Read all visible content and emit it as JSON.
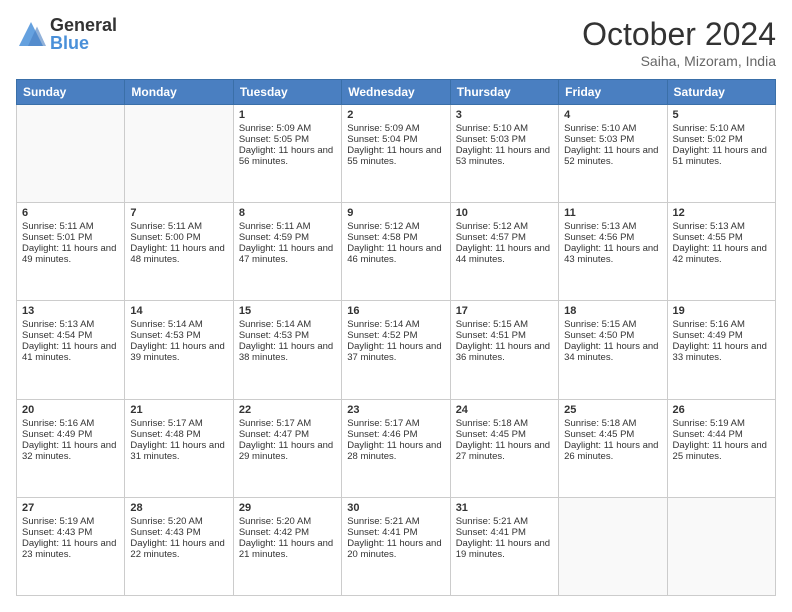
{
  "logo": {
    "general": "General",
    "blue": "Blue"
  },
  "header": {
    "month": "October 2024",
    "location": "Saiha, Mizoram, India"
  },
  "weekdays": [
    "Sunday",
    "Monday",
    "Tuesday",
    "Wednesday",
    "Thursday",
    "Friday",
    "Saturday"
  ],
  "weeks": [
    [
      {
        "day": "",
        "content": ""
      },
      {
        "day": "",
        "content": ""
      },
      {
        "day": "1",
        "content": "Sunrise: 5:09 AM\nSunset: 5:05 PM\nDaylight: 11 hours and 56 minutes."
      },
      {
        "day": "2",
        "content": "Sunrise: 5:09 AM\nSunset: 5:04 PM\nDaylight: 11 hours and 55 minutes."
      },
      {
        "day": "3",
        "content": "Sunrise: 5:10 AM\nSunset: 5:03 PM\nDaylight: 11 hours and 53 minutes."
      },
      {
        "day": "4",
        "content": "Sunrise: 5:10 AM\nSunset: 5:03 PM\nDaylight: 11 hours and 52 minutes."
      },
      {
        "day": "5",
        "content": "Sunrise: 5:10 AM\nSunset: 5:02 PM\nDaylight: 11 hours and 51 minutes."
      }
    ],
    [
      {
        "day": "6",
        "content": "Sunrise: 5:11 AM\nSunset: 5:01 PM\nDaylight: 11 hours and 49 minutes."
      },
      {
        "day": "7",
        "content": "Sunrise: 5:11 AM\nSunset: 5:00 PM\nDaylight: 11 hours and 48 minutes."
      },
      {
        "day": "8",
        "content": "Sunrise: 5:11 AM\nSunset: 4:59 PM\nDaylight: 11 hours and 47 minutes."
      },
      {
        "day": "9",
        "content": "Sunrise: 5:12 AM\nSunset: 4:58 PM\nDaylight: 11 hours and 46 minutes."
      },
      {
        "day": "10",
        "content": "Sunrise: 5:12 AM\nSunset: 4:57 PM\nDaylight: 11 hours and 44 minutes."
      },
      {
        "day": "11",
        "content": "Sunrise: 5:13 AM\nSunset: 4:56 PM\nDaylight: 11 hours and 43 minutes."
      },
      {
        "day": "12",
        "content": "Sunrise: 5:13 AM\nSunset: 4:55 PM\nDaylight: 11 hours and 42 minutes."
      }
    ],
    [
      {
        "day": "13",
        "content": "Sunrise: 5:13 AM\nSunset: 4:54 PM\nDaylight: 11 hours and 41 minutes."
      },
      {
        "day": "14",
        "content": "Sunrise: 5:14 AM\nSunset: 4:53 PM\nDaylight: 11 hours and 39 minutes."
      },
      {
        "day": "15",
        "content": "Sunrise: 5:14 AM\nSunset: 4:53 PM\nDaylight: 11 hours and 38 minutes."
      },
      {
        "day": "16",
        "content": "Sunrise: 5:14 AM\nSunset: 4:52 PM\nDaylight: 11 hours and 37 minutes."
      },
      {
        "day": "17",
        "content": "Sunrise: 5:15 AM\nSunset: 4:51 PM\nDaylight: 11 hours and 36 minutes."
      },
      {
        "day": "18",
        "content": "Sunrise: 5:15 AM\nSunset: 4:50 PM\nDaylight: 11 hours and 34 minutes."
      },
      {
        "day": "19",
        "content": "Sunrise: 5:16 AM\nSunset: 4:49 PM\nDaylight: 11 hours and 33 minutes."
      }
    ],
    [
      {
        "day": "20",
        "content": "Sunrise: 5:16 AM\nSunset: 4:49 PM\nDaylight: 11 hours and 32 minutes."
      },
      {
        "day": "21",
        "content": "Sunrise: 5:17 AM\nSunset: 4:48 PM\nDaylight: 11 hours and 31 minutes."
      },
      {
        "day": "22",
        "content": "Sunrise: 5:17 AM\nSunset: 4:47 PM\nDaylight: 11 hours and 29 minutes."
      },
      {
        "day": "23",
        "content": "Sunrise: 5:17 AM\nSunset: 4:46 PM\nDaylight: 11 hours and 28 minutes."
      },
      {
        "day": "24",
        "content": "Sunrise: 5:18 AM\nSunset: 4:45 PM\nDaylight: 11 hours and 27 minutes."
      },
      {
        "day": "25",
        "content": "Sunrise: 5:18 AM\nSunset: 4:45 PM\nDaylight: 11 hours and 26 minutes."
      },
      {
        "day": "26",
        "content": "Sunrise: 5:19 AM\nSunset: 4:44 PM\nDaylight: 11 hours and 25 minutes."
      }
    ],
    [
      {
        "day": "27",
        "content": "Sunrise: 5:19 AM\nSunset: 4:43 PM\nDaylight: 11 hours and 23 minutes."
      },
      {
        "day": "28",
        "content": "Sunrise: 5:20 AM\nSunset: 4:43 PM\nDaylight: 11 hours and 22 minutes."
      },
      {
        "day": "29",
        "content": "Sunrise: 5:20 AM\nSunset: 4:42 PM\nDaylight: 11 hours and 21 minutes."
      },
      {
        "day": "30",
        "content": "Sunrise: 5:21 AM\nSunset: 4:41 PM\nDaylight: 11 hours and 20 minutes."
      },
      {
        "day": "31",
        "content": "Sunrise: 5:21 AM\nSunset: 4:41 PM\nDaylight: 11 hours and 19 minutes."
      },
      {
        "day": "",
        "content": ""
      },
      {
        "day": "",
        "content": ""
      }
    ]
  ]
}
